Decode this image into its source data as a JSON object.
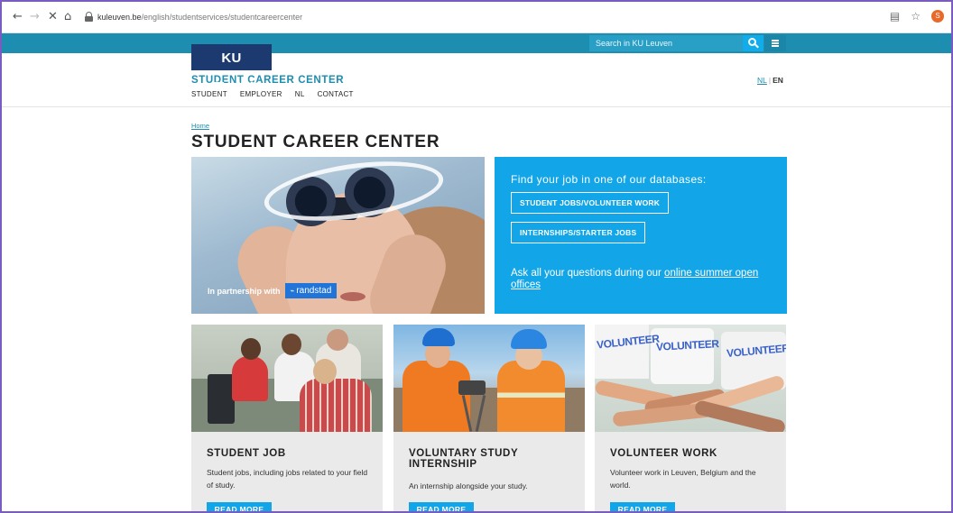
{
  "browser": {
    "url_host": "kuleuven.be",
    "url_path": "/english/studentservices/studentcareercenter",
    "profile_initial": "S"
  },
  "site": {
    "logo_text": "KU LEUVEN",
    "search_placeholder": "Search in KU Leuven",
    "title": "STUDENT CAREER CENTER",
    "nav": [
      "STUDENT",
      "EMPLOYER",
      "NL",
      "CONTACT"
    ],
    "lang_nl": "NL",
    "lang_sep": "|",
    "lang_en": "EN",
    "brand_color": "#1d8db0",
    "accent_color": "#12a5e7"
  },
  "page": {
    "breadcrumb": "Home",
    "title": "STUDENT CAREER CENTER"
  },
  "hero": {
    "partnership_text": "In partnership with",
    "partner_name": "randstad"
  },
  "promo": {
    "heading": "Find your job in one of our databases:",
    "button_1": "STUDENT JOBS/VOLUNTEER WORK",
    "button_2": "INTERNSHIPS/STARTER JOBS",
    "footer_prefix": "Ask all your questions during our ",
    "footer_link": "online summer open offices"
  },
  "cards": [
    {
      "title": "STUDENT JOB",
      "description": "Student jobs, including jobs related to your field of study.",
      "button": "READ MORE"
    },
    {
      "title": "VOLUNTARY STUDY INTERNSHIP",
      "description": "An internship alongside your study.",
      "button": "READ MORE"
    },
    {
      "title": "VOLUNTEER WORK",
      "description": "Volunteer work in Leuven, Belgium and the world.",
      "button": "READ MORE",
      "image_shirt_text": "VOLUNTEER"
    }
  ]
}
